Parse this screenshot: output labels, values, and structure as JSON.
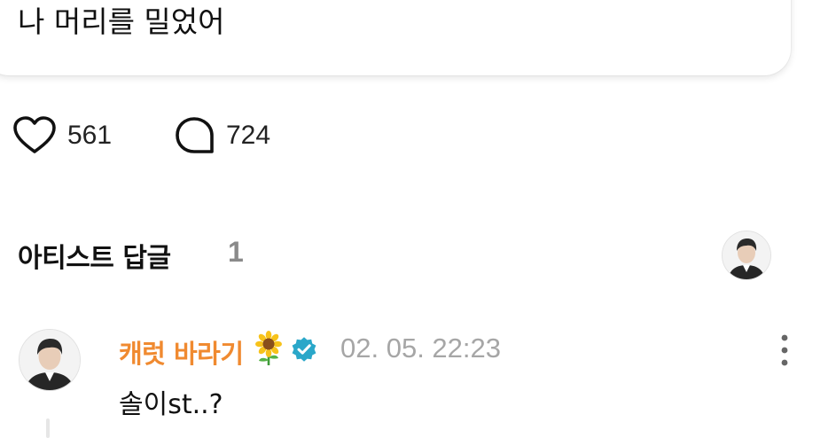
{
  "post": {
    "text": "나 머리를 밀었어"
  },
  "actions": {
    "like_count": "561",
    "reply_count": "724"
  },
  "artist_replies": {
    "title": "아티스트 답글",
    "count": "1"
  },
  "comment": {
    "author": "캐럿 바라기",
    "emoji": "sunflower",
    "verified_color": "#2aa7c9",
    "timestamp": "02. 05. 22:23",
    "text": "솔이st..?"
  },
  "colors": {
    "author_name": "#f08a30",
    "muted": "#a6a6a6"
  }
}
